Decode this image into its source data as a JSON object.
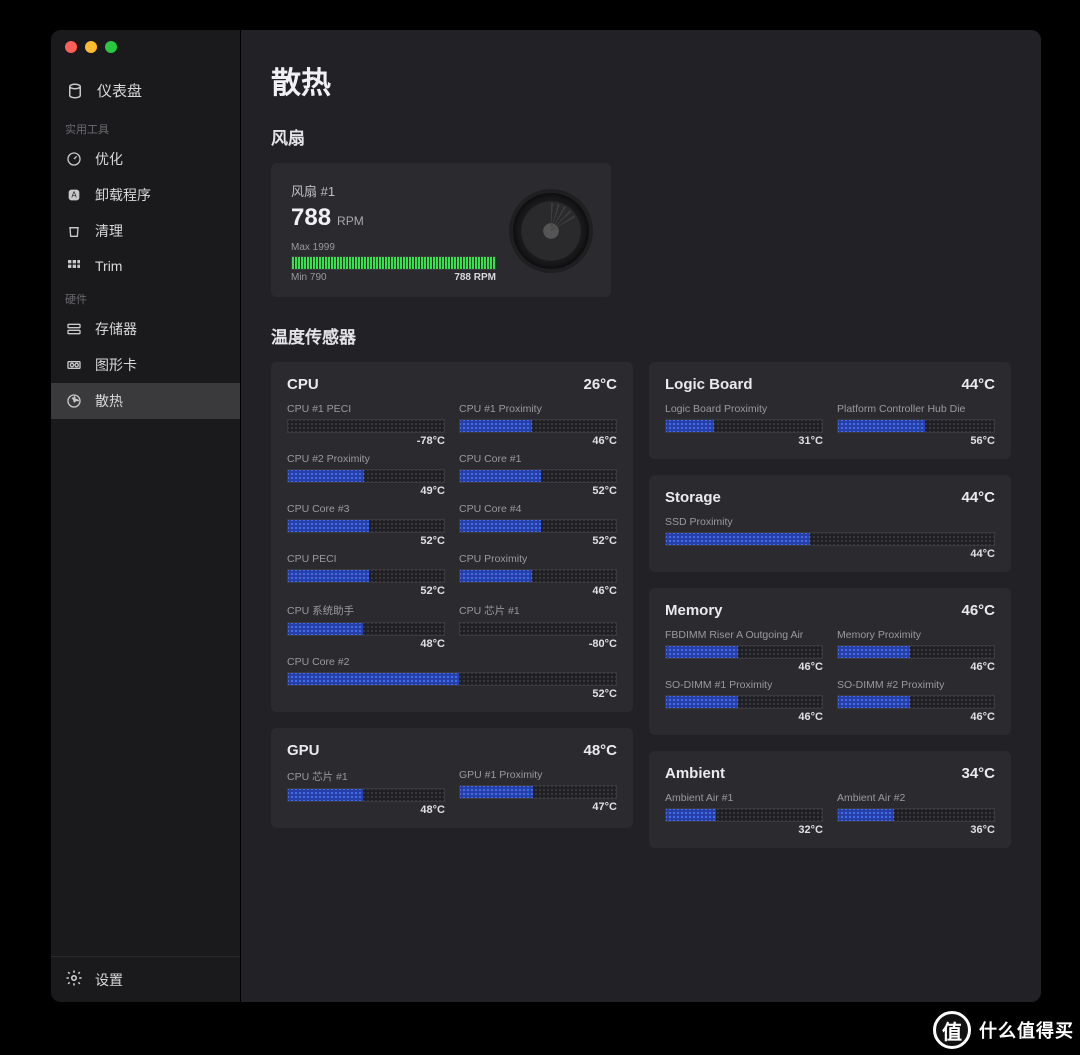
{
  "sidebar": {
    "dashboard": "仪表盘",
    "section_tools": "实用工具",
    "section_hw": "硬件",
    "items": {
      "optimize": "优化",
      "uninstall": "卸载程序",
      "clean": "清理",
      "trim": "Trim",
      "storage": "存储器",
      "gpu": "图形卡",
      "thermal": "散热"
    },
    "settings": "设置"
  },
  "page": {
    "title": "散热",
    "fans_heading": "风扇",
    "sensors_heading": "温度传感器"
  },
  "fan": {
    "name": "风扇 #1",
    "rpm": "788",
    "unit": "RPM",
    "max": "Max 1999",
    "min": "Min 790",
    "current": "788 RPM"
  },
  "groups": {
    "cpu": {
      "title": "CPU",
      "temp": "26°C"
    },
    "gpu": {
      "title": "GPU",
      "temp": "48°C"
    },
    "logic": {
      "title": "Logic Board",
      "temp": "44°C"
    },
    "storage": {
      "title": "Storage",
      "temp": "44°C"
    },
    "memory": {
      "title": "Memory",
      "temp": "46°C"
    },
    "ambient": {
      "title": "Ambient",
      "temp": "34°C"
    }
  },
  "sensors": {
    "cpu": [
      {
        "label": "CPU #1 PECI",
        "val": "-78°C",
        "pct": 0
      },
      {
        "label": "CPU #1 Proximity",
        "val": "46°C",
        "pct": 46
      },
      {
        "label": "CPU #2 Proximity",
        "val": "49°C",
        "pct": 49
      },
      {
        "label": "CPU Core #1",
        "val": "52°C",
        "pct": 52
      },
      {
        "label": "CPU Core #3",
        "val": "52°C",
        "pct": 52
      },
      {
        "label": "CPU Core #4",
        "val": "52°C",
        "pct": 52
      },
      {
        "label": "CPU PECI",
        "val": "52°C",
        "pct": 52
      },
      {
        "label": "CPU Proximity",
        "val": "46°C",
        "pct": 46
      },
      {
        "label": "CPU 系统助手",
        "val": "48°C",
        "pct": 48
      },
      {
        "label": "CPU 芯片 #1",
        "val": "-80°C",
        "pct": 0
      },
      {
        "label": "CPU Core #2",
        "val": "52°C",
        "pct": 52,
        "wide": true
      }
    ],
    "gpu": [
      {
        "label": "CPU 芯片 #1",
        "val": "48°C",
        "pct": 48
      },
      {
        "label": "GPU #1 Proximity",
        "val": "47°C",
        "pct": 47
      }
    ],
    "logic": [
      {
        "label": "Logic Board Proximity",
        "val": "31°C",
        "pct": 31
      },
      {
        "label": "Platform Controller Hub Die",
        "val": "56°C",
        "pct": 56
      }
    ],
    "storage": [
      {
        "label": "SSD Proximity",
        "val": "44°C",
        "pct": 44,
        "wide": true
      }
    ],
    "memory": [
      {
        "label": "FBDIMM Riser A Outgoing Air",
        "val": "46°C",
        "pct": 46
      },
      {
        "label": "Memory Proximity",
        "val": "46°C",
        "pct": 46
      },
      {
        "label": "SO-DIMM #1 Proximity",
        "val": "46°C",
        "pct": 46
      },
      {
        "label": "SO-DIMM #2 Proximity",
        "val": "46°C",
        "pct": 46
      }
    ],
    "ambient": [
      {
        "label": "Ambient Air #1",
        "val": "32°C",
        "pct": 32
      },
      {
        "label": "Ambient Air #2",
        "val": "36°C",
        "pct": 36
      }
    ]
  },
  "watermark": {
    "badge": "值",
    "text": "什么值得买"
  }
}
